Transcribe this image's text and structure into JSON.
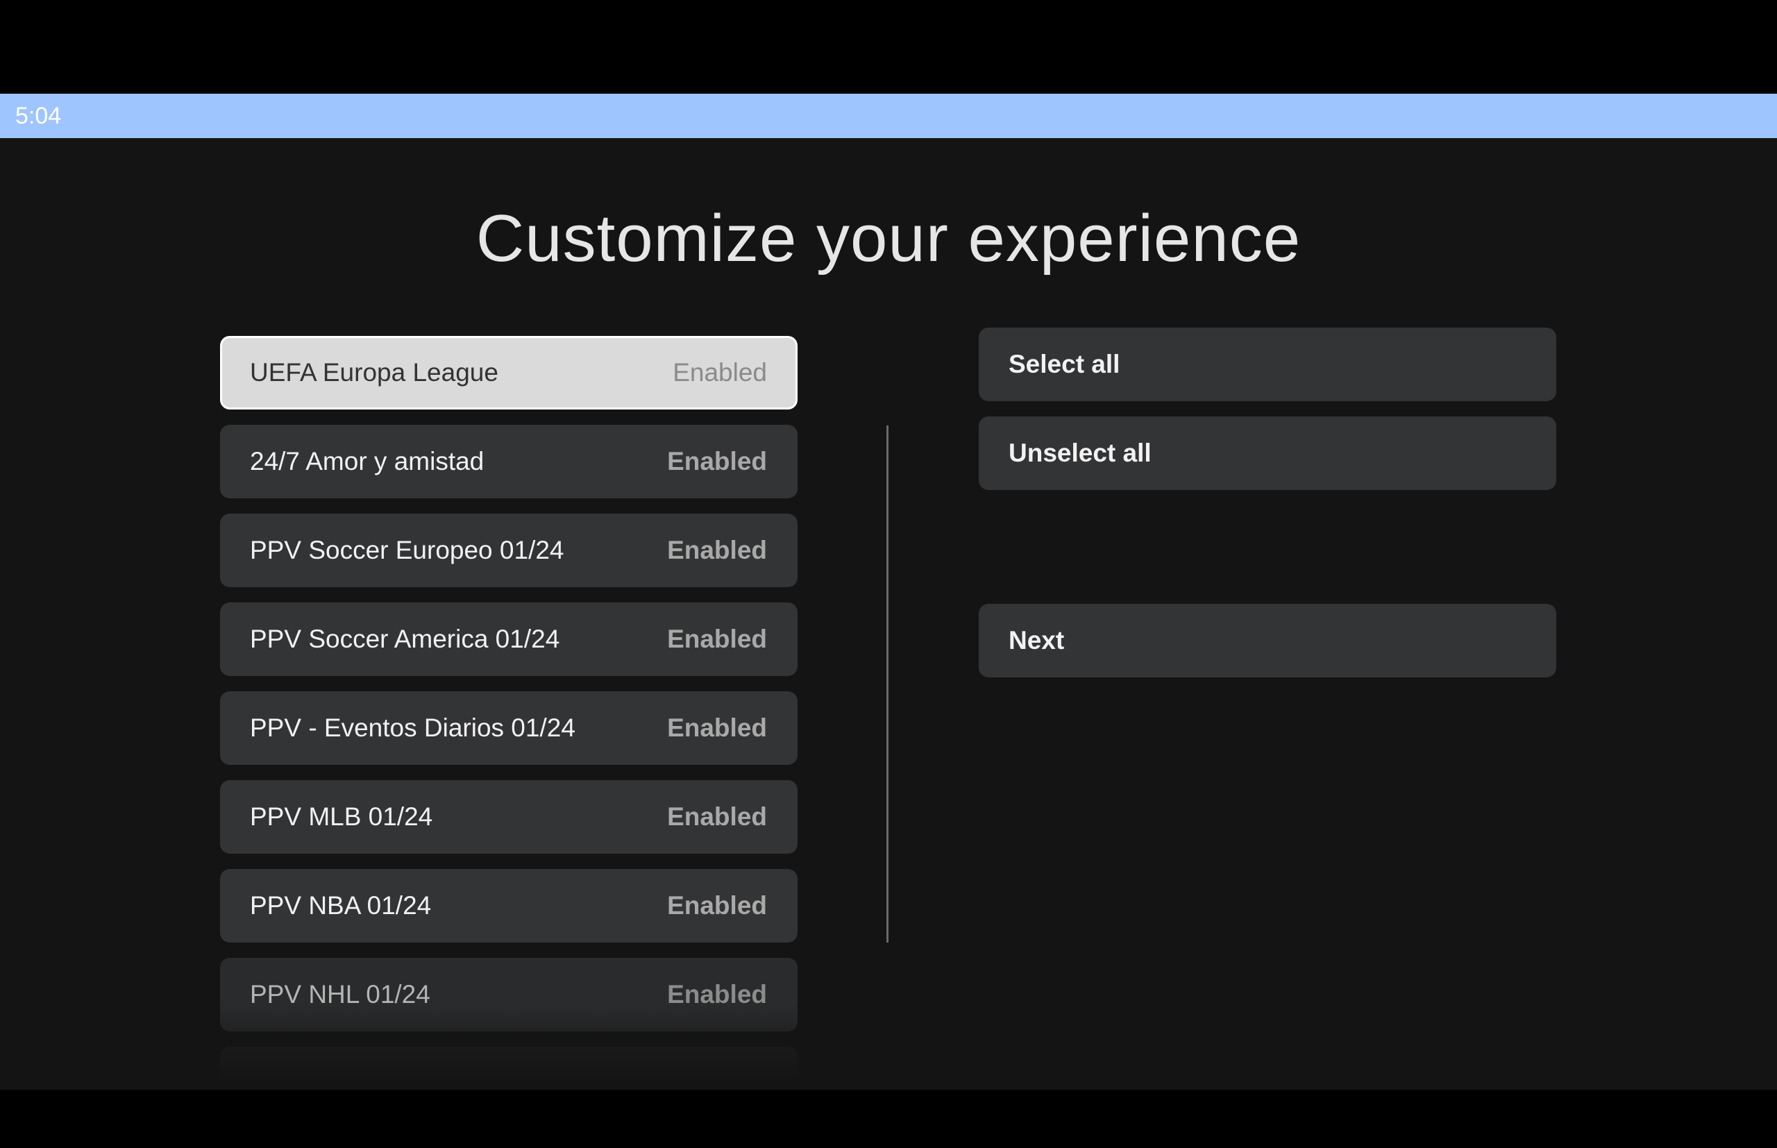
{
  "status_bar": {
    "time": "5:04"
  },
  "page": {
    "title": "Customize your experience"
  },
  "channel_list": {
    "items": [
      {
        "label": "UEFA Europa League",
        "status": "Enabled"
      },
      {
        "label": "24/7 Amor y amistad",
        "status": "Enabled"
      },
      {
        "label": "PPV Soccer Europeo 01/24",
        "status": "Enabled"
      },
      {
        "label": "PPV Soccer America 01/24",
        "status": "Enabled"
      },
      {
        "label": "PPV - Eventos Diarios 01/24",
        "status": "Enabled"
      },
      {
        "label": "PPV MLB 01/24",
        "status": "Enabled"
      },
      {
        "label": "PPV NBA 01/24",
        "status": "Enabled"
      },
      {
        "label": "PPV NHL 01/24",
        "status": "Enabled"
      }
    ]
  },
  "actions": {
    "select_all": "Select all",
    "unselect_all": "Unselect all",
    "next": "Next"
  },
  "colors": {
    "status_bar": "#9fc5ff",
    "background": "#141414",
    "item_background": "#333436",
    "focused_item_background": "#dadada"
  }
}
